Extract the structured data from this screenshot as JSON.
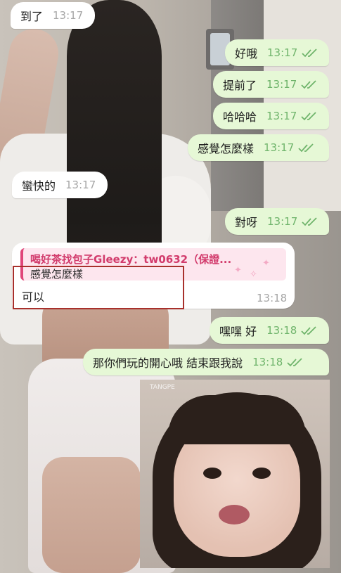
{
  "messages": [
    {
      "text": "到了",
      "time": "13:17",
      "dir": "in"
    },
    {
      "text": "好哦",
      "time": "13:17",
      "dir": "out"
    },
    {
      "text": "提前了",
      "time": "13:17",
      "dir": "out"
    },
    {
      "text": "哈哈哈",
      "time": "13:17",
      "dir": "out"
    },
    {
      "text": "感覺怎麼樣",
      "time": "13:17",
      "dir": "out"
    },
    {
      "text": "蠻快的",
      "time": "13:17",
      "dir": "in"
    },
    {
      "text": "對呀",
      "time": "13:17",
      "dir": "out"
    },
    {
      "text": "嘿嘿 好",
      "time": "13:18",
      "dir": "out"
    },
    {
      "text": "那你們玩的開心哦 結束跟我說",
      "time": "13:18",
      "dir": "out"
    }
  ],
  "reply": {
    "quoted_sender": "喝好茶找包子Gleezy：tw0632（保證...",
    "quoted_text": "感覺怎麼樣",
    "text": "可以",
    "time": "13:18"
  },
  "sticker": {
    "watermark": "TANGPE"
  },
  "colors": {
    "outgoing_bubble": "#e6f8d6",
    "incoming_bubble": "#ffffff",
    "read_check": "#6fb46b",
    "quote_accent": "#e0467a"
  }
}
